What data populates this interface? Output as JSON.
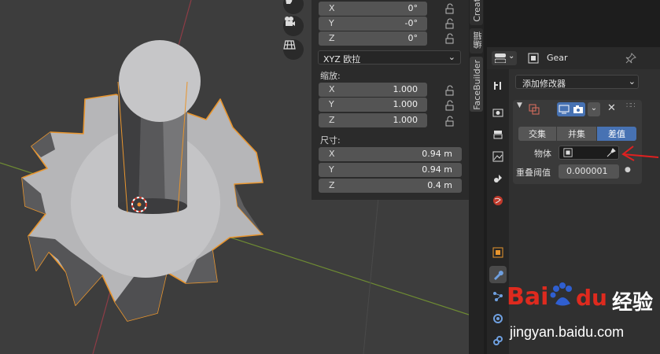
{
  "viewport": {
    "icons": [
      "hand-icon",
      "camera-icon",
      "grid-icon"
    ]
  },
  "npanel": {
    "rotation": [
      {
        "axis": "X",
        "value": "0°"
      },
      {
        "axis": "Y",
        "value": "-0°"
      },
      {
        "axis": "Z",
        "value": "0°"
      }
    ],
    "rotation_mode": "XYZ 欧拉",
    "scale_label": "缩放:",
    "scale": [
      {
        "axis": "X",
        "value": "1.000"
      },
      {
        "axis": "Y",
        "value": "1.000"
      },
      {
        "axis": "Z",
        "value": "1.000"
      }
    ],
    "dimensions_label": "尺寸:",
    "dimensions": [
      {
        "axis": "X",
        "value": "0.94 m"
      },
      {
        "axis": "Y",
        "value": "0.94 m"
      },
      {
        "axis": "Z",
        "value": "0.4 m"
      }
    ]
  },
  "side_tabs": [
    "Creat",
    "编辑",
    "FaceBuilder"
  ],
  "properties": {
    "object_name": "Gear",
    "add_modifier": "添加修改器",
    "operations": [
      "交集",
      "并集",
      "差值"
    ],
    "active_operation": 2,
    "object_label": "物体",
    "overlap_label": "重叠阈值",
    "overlap_value": "0.000001"
  },
  "watermark": {
    "brand_a": "Bai",
    "brand_b": "du",
    "brand_cn": "经验",
    "url": "jingyan.baidu.com"
  },
  "colors": {
    "accent": "#4772b3",
    "selection_outline": "#e8952e",
    "annotation_arrow": "#e02020",
    "watermark_red": "#de2a1e",
    "watermark_blue": "#2f5fd0"
  }
}
